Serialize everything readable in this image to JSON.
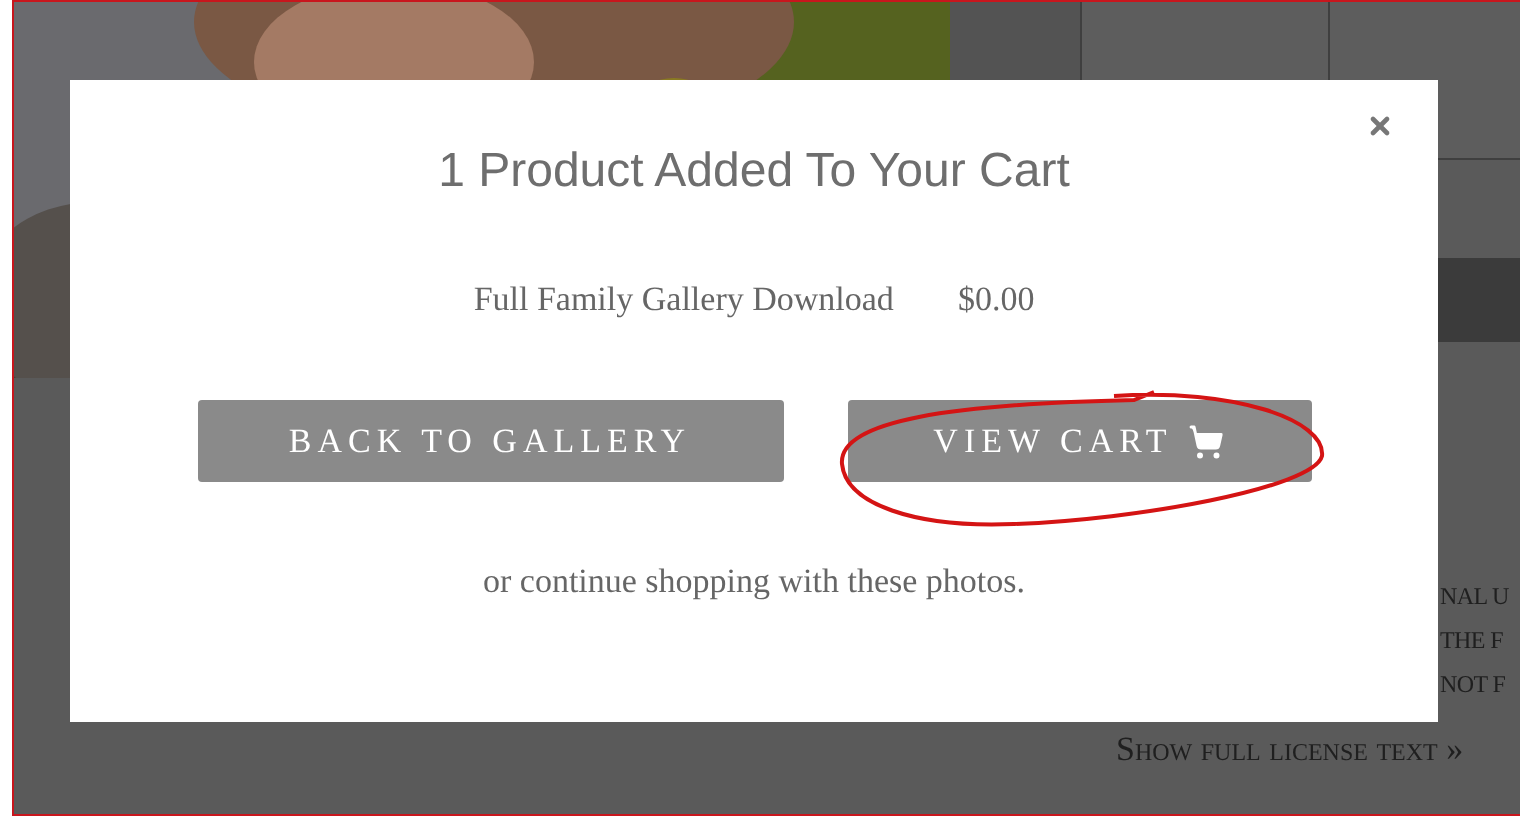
{
  "background": {
    "license_lines": [
      "NAL U",
      "THE F",
      "NOT F"
    ],
    "license_link": "Show full license text »"
  },
  "modal": {
    "title": "1 Product Added To Your Cart",
    "item": {
      "name": "Full Family Gallery Download",
      "price": "$0.00"
    },
    "buttons": [
      {
        "label": "BACK TO GALLERY",
        "kind": "plain"
      },
      {
        "label": "VIEW CART",
        "kind": "cart"
      }
    ],
    "note": "or continue shopping with these photos."
  }
}
